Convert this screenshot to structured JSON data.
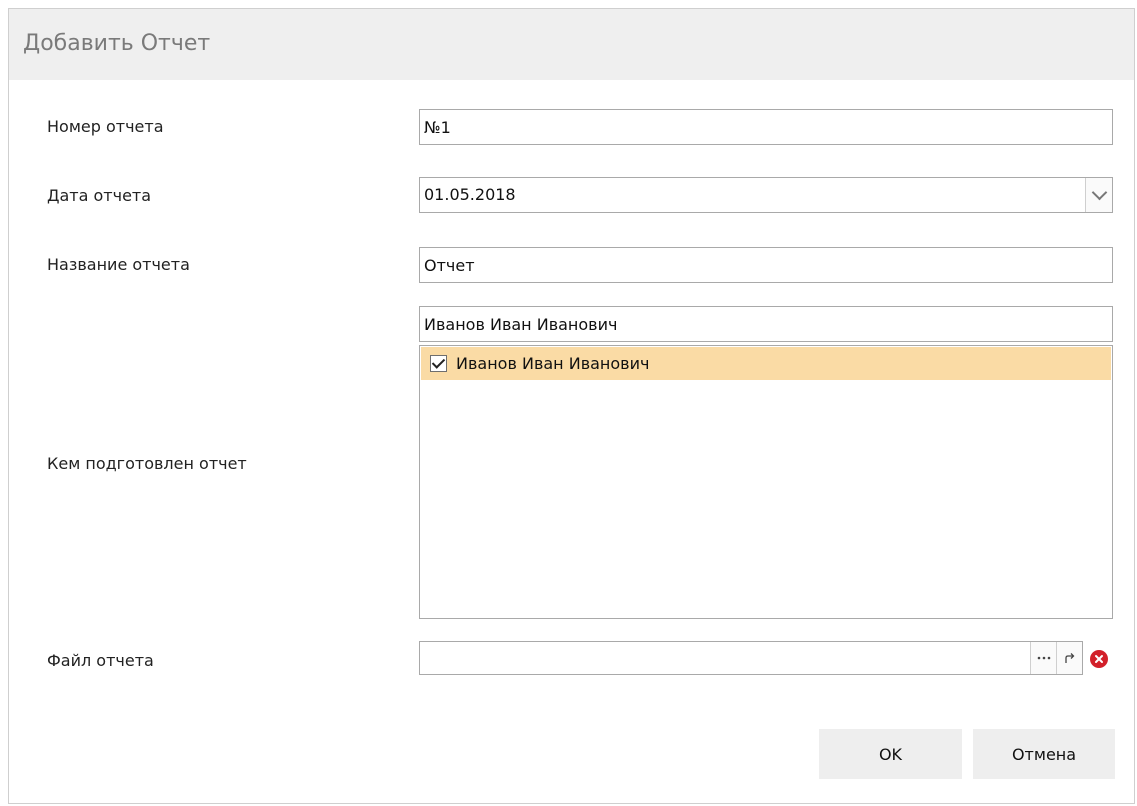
{
  "dialog": {
    "title": "Добавить Отчет"
  },
  "form": {
    "report_number_label": "Номер отчета",
    "report_number_value": "№1",
    "report_date_label": "Дата отчета",
    "report_date_value": "01.05.2018",
    "report_name_label": "Название отчета",
    "report_name_value": "Отчет",
    "prepared_by_label": "Кем подготовлен отчет",
    "prepared_by_filter_value": "Иванов Иван Иванович",
    "prepared_by_items": [
      {
        "label": "Иванов Иван Иванович",
        "checked": true,
        "selected": true
      }
    ],
    "report_file_label": "Файл отчета",
    "report_file_value": ""
  },
  "icons": {
    "date_dropdown": "chevron-down-icon",
    "browse": "ellipsis-icon",
    "open": "open-external-icon",
    "clear": "clear-red-icon",
    "checkbox": "check-icon"
  },
  "colors": {
    "title_bar_bg": "#efefef",
    "selected_item_bg": "#fadba5",
    "clear_icon": "#d2202a",
    "button_bg": "#eeeeee"
  },
  "buttons": {
    "ok_label": "OK",
    "cancel_label": "Отмена"
  }
}
